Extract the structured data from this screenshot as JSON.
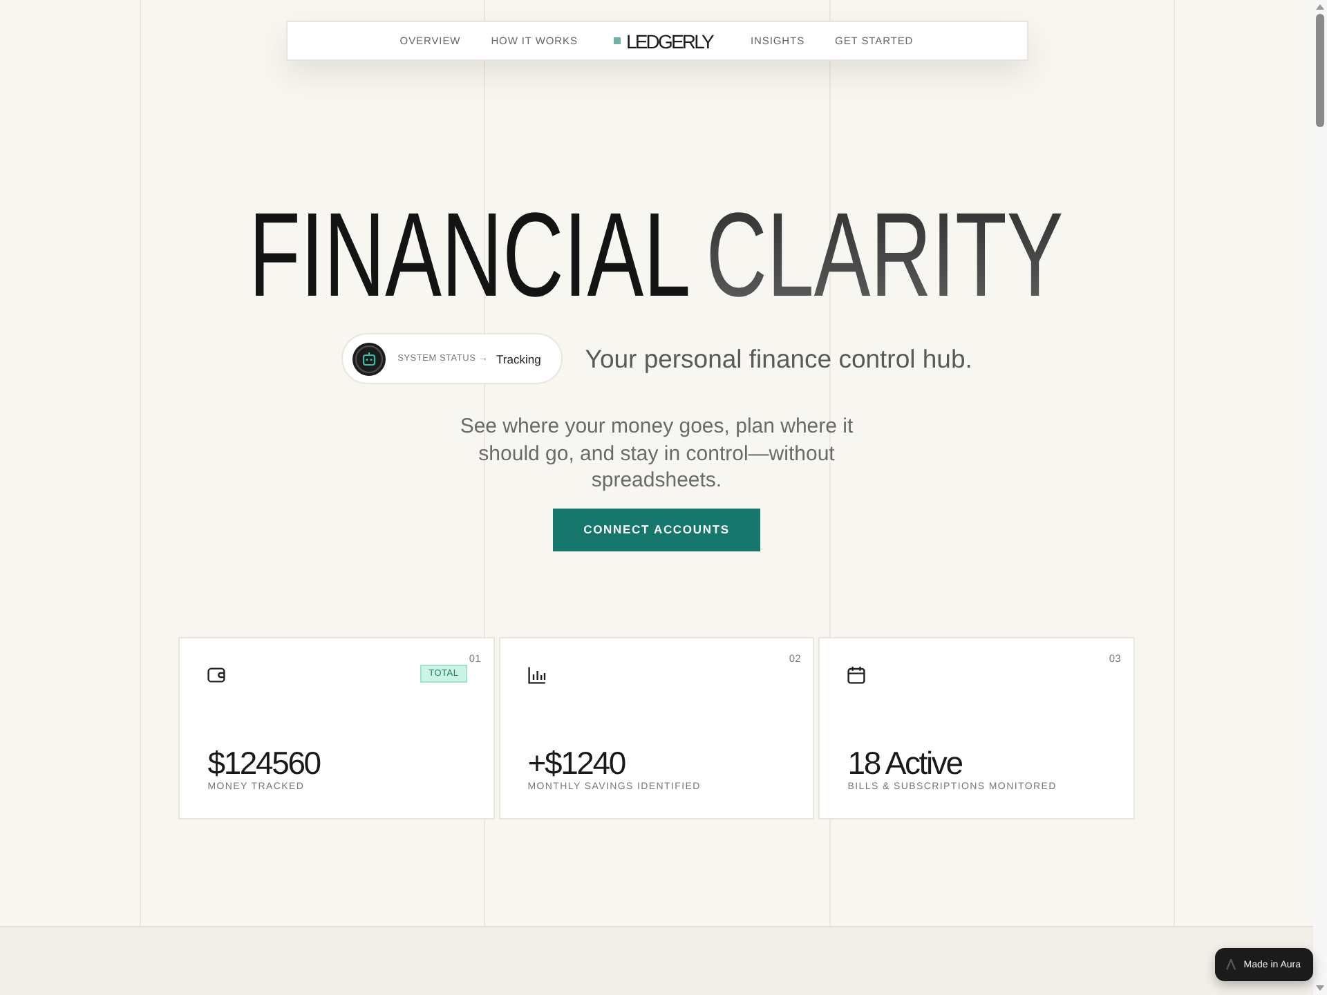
{
  "nav": {
    "links_left": [
      {
        "label": "OVERVIEW"
      },
      {
        "label": "HOW IT WORKS"
      }
    ],
    "brand": "LEDGERLY",
    "links_right": [
      {
        "label": "INSIGHTS"
      },
      {
        "label": "GET STARTED"
      }
    ]
  },
  "hero": {
    "headline": {
      "lead": "FINANCIAL",
      "accent": "CLARITY"
    },
    "status_badge": {
      "label": "SYSTEM STATUS →",
      "value": "Tracking"
    },
    "tagline": "Your personal finance control hub.",
    "description": "See where your money goes, plan where it should go, and stay in control—without spreadsheets.",
    "cta": "CONNECT ACCOUNTS"
  },
  "stats": [
    {
      "index": "01",
      "kind": "wallet",
      "tag": "TOTAL",
      "value": "$124560",
      "label": "MONEY TRACKED"
    },
    {
      "index": "02",
      "kind": "chart",
      "value": "+$1240",
      "label": "MONTHLY SAVINGS IDENTIFIED"
    },
    {
      "index": "03",
      "kind": "calendar",
      "value": "18 Active",
      "label": "BILLS & SUBSCRIPTIONS MONITORED"
    }
  ],
  "made_in_badge": "Made in Aura"
}
